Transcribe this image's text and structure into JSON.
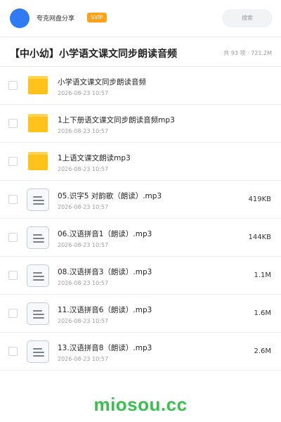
{
  "header": {
    "username": "夸克网盘分享",
    "badge": "SVIP",
    "search_placeholder": "搜索",
    "avatar_color": "#2f7bf5",
    "badge_color": "#ffa21a"
  },
  "share": {
    "title": "【中小幼】小学语文课文同步朗读音频",
    "meta": "共 93 项 · 721.2M"
  },
  "files": [
    {
      "type": "folder",
      "name": "小学语文课文同步朗读音频",
      "date": "2026-08-23 10:57",
      "size": ""
    },
    {
      "type": "folder",
      "name": "1上下册语文课文同步朗读音频mp3",
      "date": "2026-08-23 10:57",
      "size": ""
    },
    {
      "type": "folder",
      "name": "1上语文课文朗读mp3",
      "date": "2026-08-23 10:57",
      "size": ""
    },
    {
      "type": "file",
      "name": "05.识字5 对韵歌（朗读）.mp3",
      "date": "2026-08-23 10:57",
      "size": "419KB"
    },
    {
      "type": "file",
      "name": "06.汉语拼音1（朗读）.mp3",
      "date": "2026-08-23 10:57",
      "size": "144KB"
    },
    {
      "type": "file",
      "name": "08.汉语拼音3（朗读）.mp3",
      "date": "2026-08-23 10:57",
      "size": "1.1M"
    },
    {
      "type": "file",
      "name": "11.汉语拼音6（朗读）.mp3",
      "date": "2026-08-23 10:57",
      "size": "1.6M"
    },
    {
      "type": "file",
      "name": "13.汉语拼音8（朗读）.mp3",
      "date": "2026-08-23 10:57",
      "size": "2.6M"
    }
  ],
  "watermark": {
    "text": "miosou.cc",
    "color": "#38c14c"
  }
}
